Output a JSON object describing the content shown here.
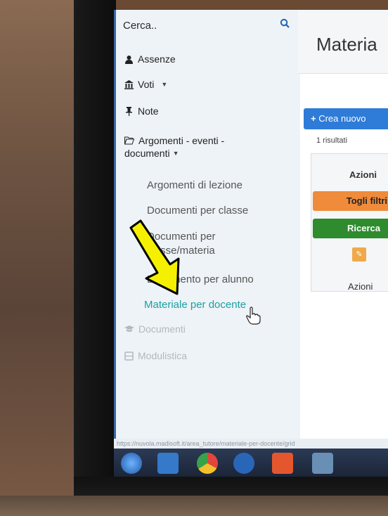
{
  "search": {
    "label": "Cerca.."
  },
  "nav": {
    "assenze": "Assenze",
    "voti": "Voti",
    "note": "Note",
    "argomenti_line1": "Argomenti - eventi -",
    "argomenti_line2": "documenti",
    "sub": [
      "Argomenti di lezione",
      "Documenti per classe",
      "Documenti per",
      "classe/materia",
      "Documento per alunno",
      "Materiale per docente"
    ],
    "documenti": "Documenti",
    "modulistica": "Modulistica"
  },
  "status_url": "https://nuvola.madisoft.it/area_tutore/materiale-per-docente/grid",
  "content": {
    "title": "Materia",
    "create_button": "Crea nuovo",
    "results": "1 risultati",
    "actions_header": "Azioni",
    "remove_filters": "Togli filtri",
    "search_button": "Ricerca",
    "actions_footer": "Azioni"
  },
  "colors": {
    "accent": "#1aa1a1",
    "primary": "#2f7bd8",
    "orange": "#ef8b3b",
    "green": "#2e8b2e",
    "highlight_arrow": "#f5f000"
  }
}
